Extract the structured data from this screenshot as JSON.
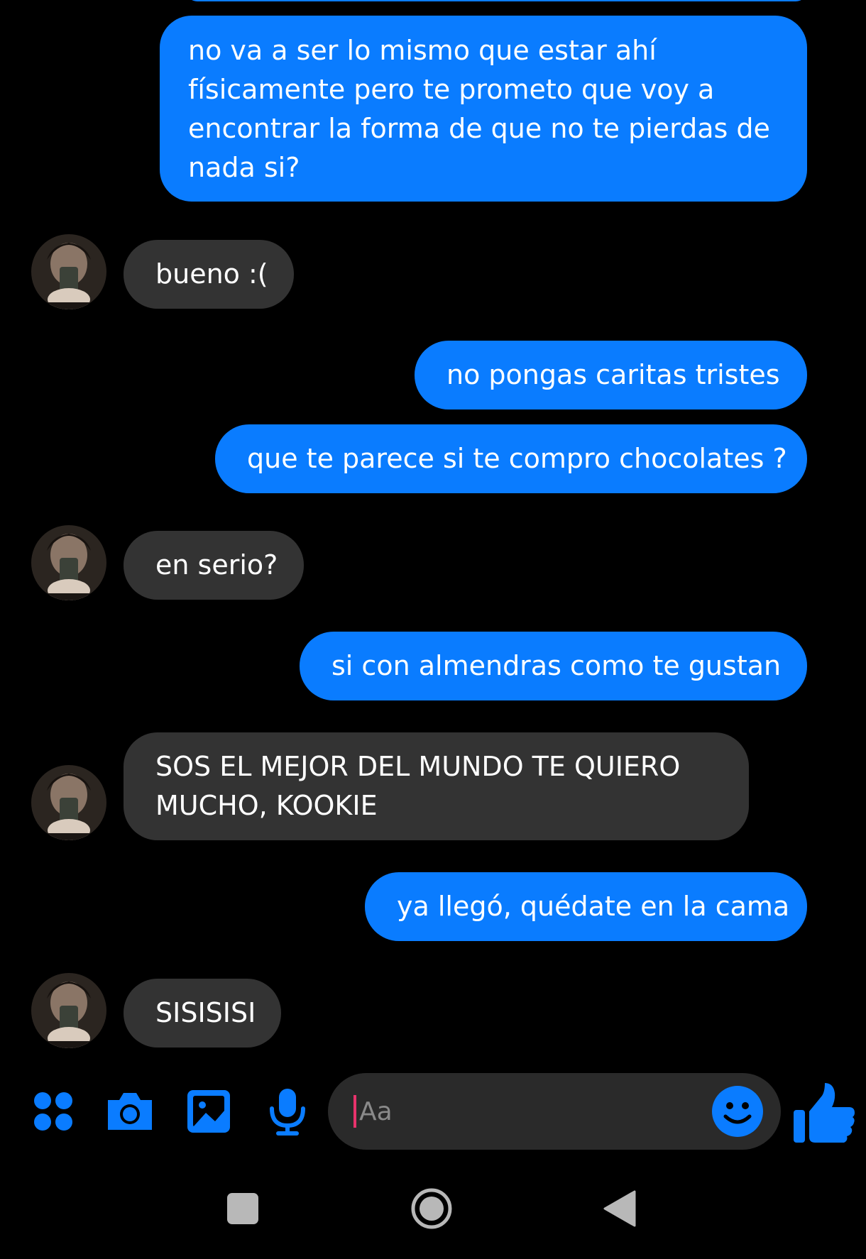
{
  "theme": {
    "outgoing_bubble": "#0a7cff",
    "incoming_bubble": "#333333",
    "accent": "#0a7cff",
    "background": "#000000",
    "caret": "#e8336c"
  },
  "messages": [
    {
      "direction": "outgoing",
      "text": "no va a ser lo mismo que estar ahí físicamente pero te prometo que voy a encontrar la forma de que no te pierdas de nada si?"
    },
    {
      "direction": "incoming",
      "text": "bueno :("
    },
    {
      "direction": "outgoing",
      "text": "no pongas caritas tristes"
    },
    {
      "direction": "outgoing",
      "text": "que te parece si te compro chocolates ?"
    },
    {
      "direction": "incoming",
      "text": "en serio?"
    },
    {
      "direction": "outgoing",
      "text": "si con almendras como te gustan"
    },
    {
      "direction": "incoming",
      "text": "SOS EL MEJOR DEL MUNDO TE QUIERO MUCHO, KOOKIE"
    },
    {
      "direction": "outgoing",
      "text": "ya llegó, quédate en la cama"
    },
    {
      "direction": "incoming",
      "text": "SISISISI"
    }
  ],
  "composer": {
    "placeholder": "Aa",
    "value": ""
  },
  "toolbar": {
    "icons": [
      "apps-icon",
      "camera-icon",
      "gallery-icon",
      "microphone-icon",
      "emoji-icon",
      "like-icon"
    ]
  },
  "navigation": {
    "icons": [
      "recents-icon",
      "home-icon",
      "back-icon"
    ]
  }
}
